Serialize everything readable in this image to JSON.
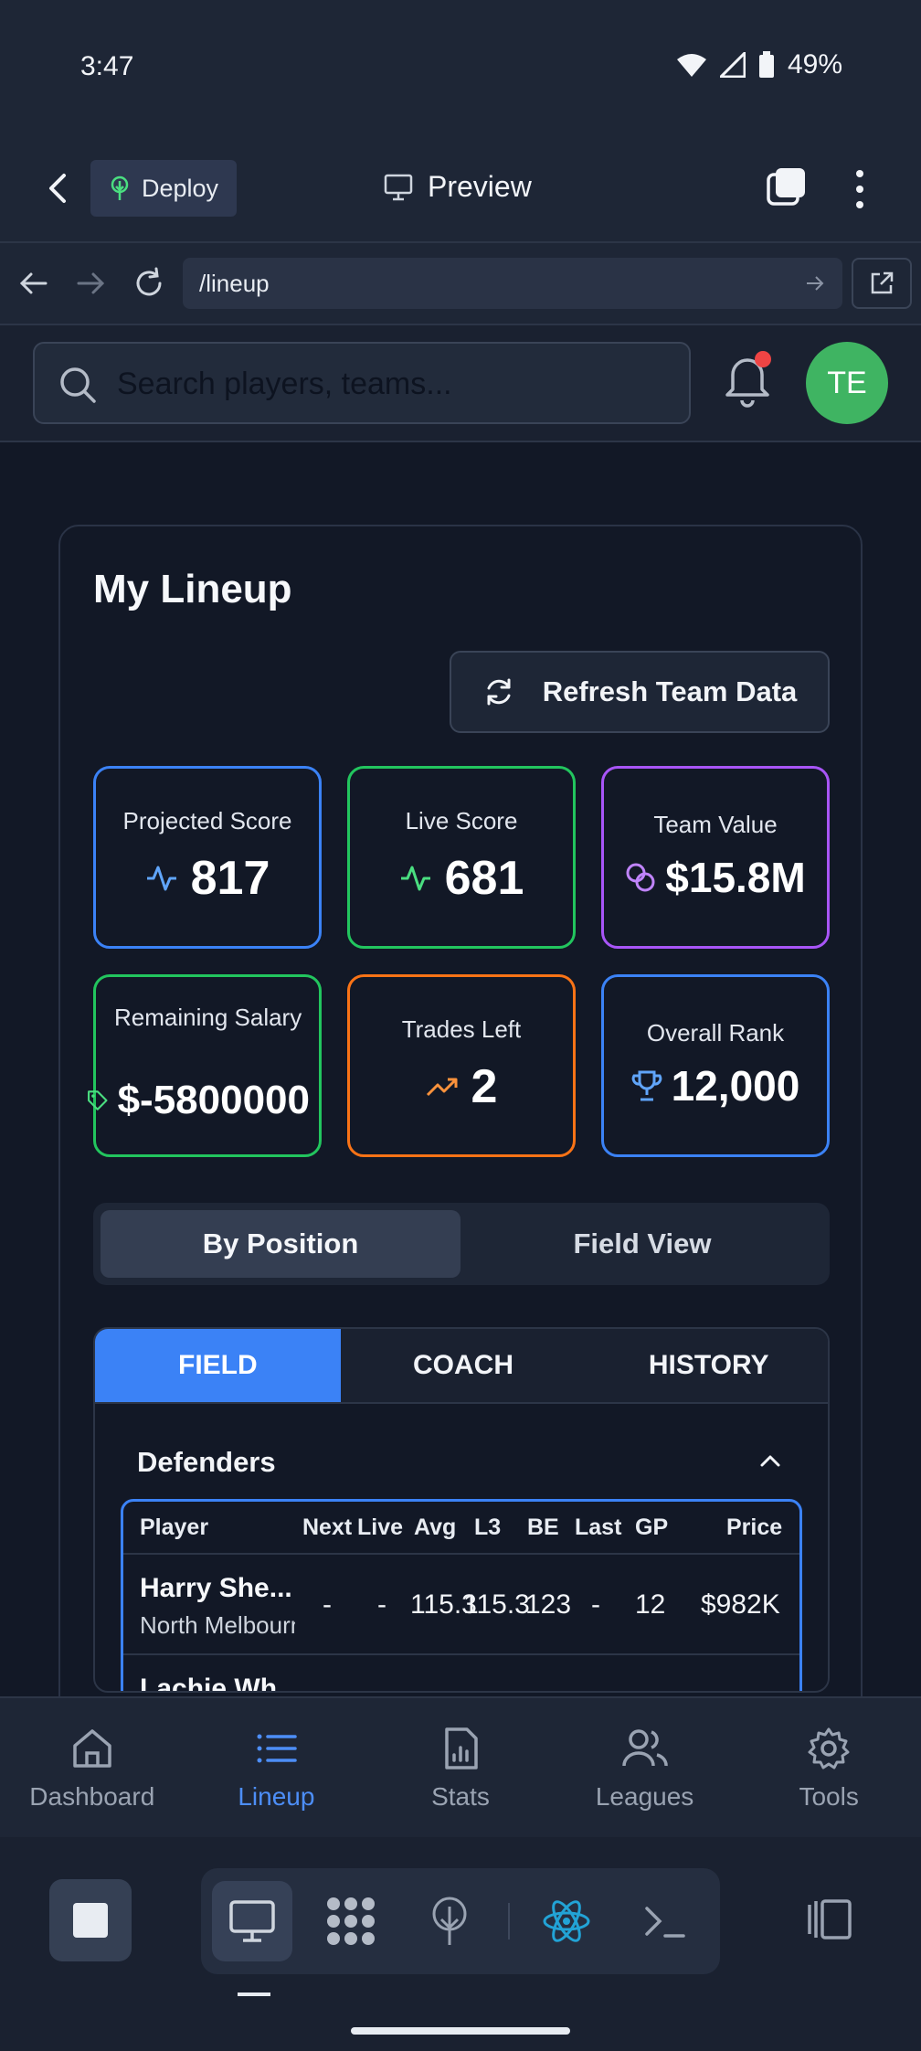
{
  "status": {
    "time": "3:47",
    "battery": "49%"
  },
  "app_header": {
    "deploy_label": "Deploy",
    "preview_label": "Preview"
  },
  "browser": {
    "url": "/lineup"
  },
  "topbar": {
    "search_placeholder": "Search players, teams...",
    "avatar_initials": "TE"
  },
  "lineup": {
    "title": "My Lineup",
    "refresh_label": "Refresh Team Data",
    "stats": [
      {
        "label": "Projected Score",
        "value": "817",
        "color": "#3b82f6",
        "icon": "activity-icon"
      },
      {
        "label": "Live Score",
        "value": "681",
        "color": "#22c55e",
        "icon": "activity-icon"
      },
      {
        "label": "Team Value",
        "value": "$15.8M",
        "color": "#a855f7",
        "icon": "coins-icon"
      },
      {
        "label": "Remaining Salary",
        "value": "$-5800000",
        "color": "#22c55e",
        "icon": "tag-icon"
      },
      {
        "label": "Trades Left",
        "value": "2",
        "color": "#f97316",
        "icon": "trending-up-icon"
      },
      {
        "label": "Overall Rank",
        "value": "12,000",
        "color": "#3b82f6",
        "icon": "trophy-icon"
      }
    ],
    "view_toggle": {
      "by_position": "By Position",
      "field_view": "Field View"
    },
    "position_tabs": [
      "FIELD",
      "COACH",
      "HISTORY"
    ],
    "section_title": "Defenders",
    "table": {
      "columns": [
        "Player",
        "Next",
        "Live",
        "Avg",
        "L3",
        "BE",
        "Last",
        "GP",
        "Price"
      ],
      "rows": [
        {
          "name": "Harry She...",
          "team": "North Melbourne",
          "next": "-",
          "live": "-",
          "avg": "115.3",
          "l3": "115.3",
          "be": "123",
          "last": "-",
          "gp": "12",
          "price": "$982K"
        },
        {
          "name": "Lachie Wh...",
          "team": "",
          "next": "",
          "live": "",
          "avg": "",
          "l3": "",
          "be": "",
          "last": "",
          "gp": "",
          "price": ""
        }
      ]
    }
  },
  "bottom_nav": [
    "Dashboard",
    "Lineup",
    "Stats",
    "Leagues",
    "Tools"
  ]
}
